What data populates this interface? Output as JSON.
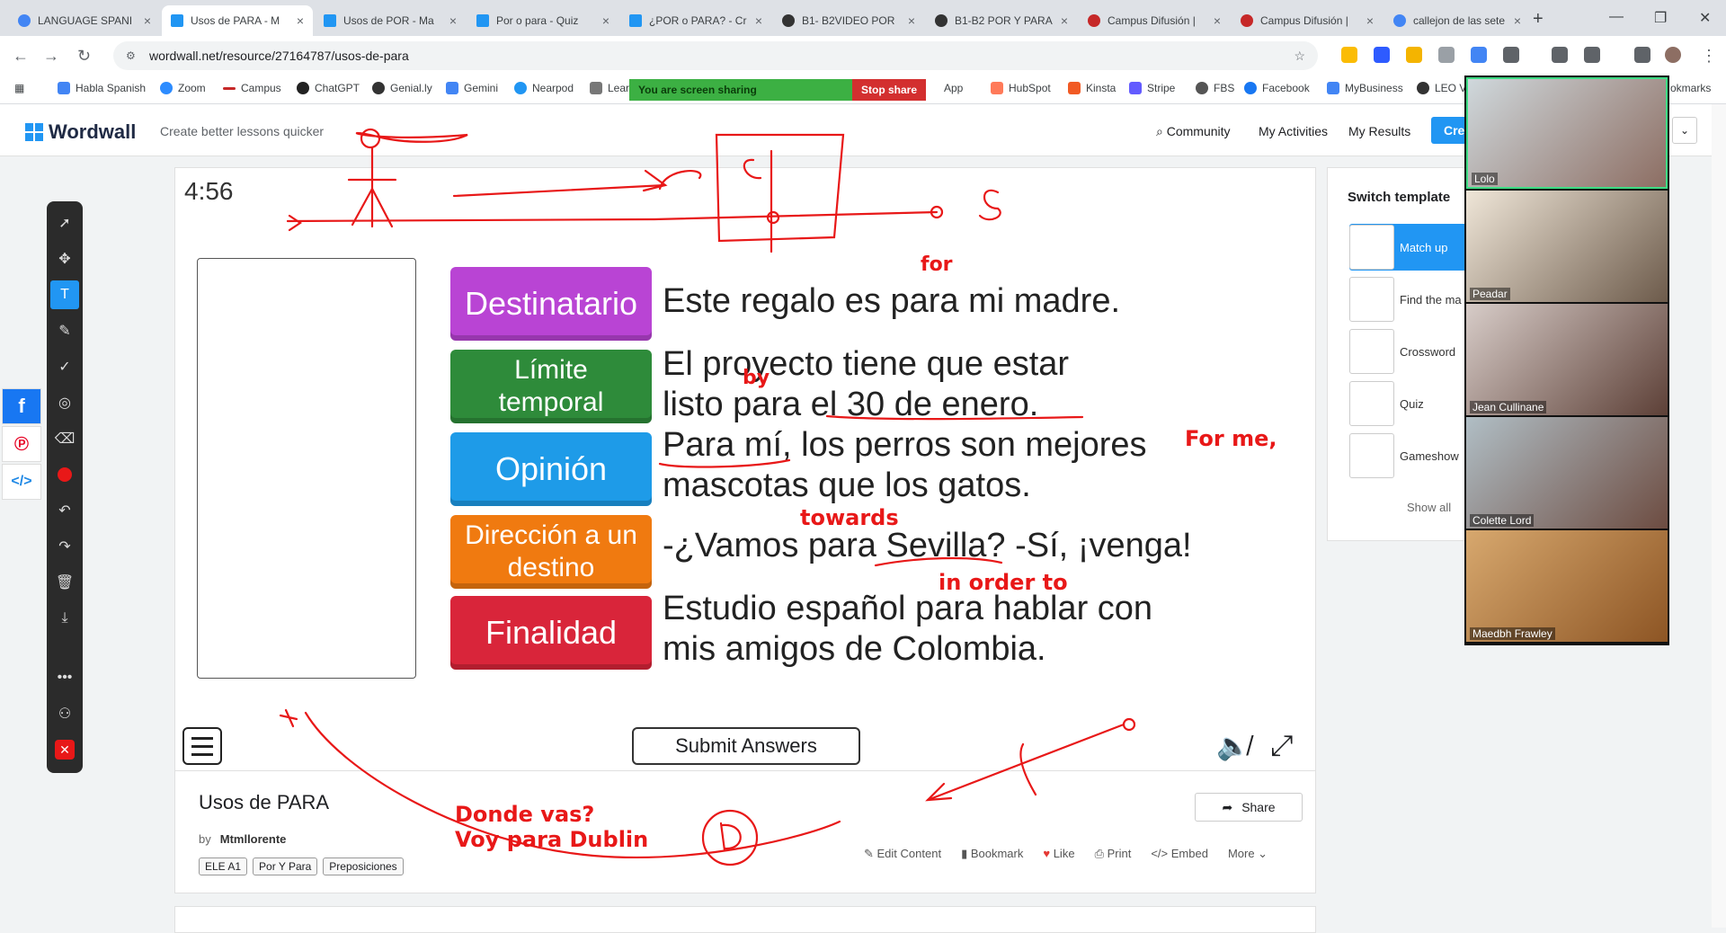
{
  "browser": {
    "tabs": [
      {
        "label": "LANGUAGE SPANI",
        "color": "#4285f4"
      },
      {
        "label": "Usos de PARA - M",
        "color": "#2196f3"
      },
      {
        "label": "Usos de POR - Ma",
        "color": "#2196f3"
      },
      {
        "label": "Por o para - Quiz",
        "color": "#2196f3"
      },
      {
        "label": "¿POR o PARA? - Cr",
        "color": "#2196f3"
      },
      {
        "label": "B1- B2VIDEO POR",
        "color": "#333333"
      },
      {
        "label": "B1-B2 POR Y PARA",
        "color": "#333333"
      },
      {
        "label": "Campus Difusión |",
        "color": "#c62828"
      },
      {
        "label": "Campus Difusión |",
        "color": "#c62828"
      },
      {
        "label": "callejon de las sete",
        "color": "#4285f4"
      }
    ],
    "url": "wordwall.net/resource/27164787/usos-de-para",
    "bookmarks": [
      "Habla Spanish",
      "Zoom",
      "Campus",
      "ChatGPT",
      "Genial.ly",
      "Gemini",
      "Nearpod",
      "Lear",
      "App",
      "HubSpot",
      "Kinsta",
      "Stripe",
      "FBS",
      "Facebook",
      "MyBusiness",
      "LEO V",
      "okmarks"
    ],
    "screen_share": {
      "status": "You are screen sharing",
      "stop": "Stop share"
    }
  },
  "wordwall": {
    "brand": "Wordwall",
    "tagline": "Create better lessons quicker",
    "nav": [
      "Community",
      "My Activities",
      "My Results"
    ],
    "create": "Cre"
  },
  "game": {
    "timer": "4:56",
    "categories": [
      {
        "label": "Destinatario",
        "color": "#b944d4"
      },
      {
        "label": "Límite temporal",
        "color": "#2e8b3a"
      },
      {
        "label": "Opinión",
        "color": "#1e9be8"
      },
      {
        "label": "Dirección a un destino",
        "color": "#f07a10"
      },
      {
        "label": "Finalidad",
        "color": "#d9253a"
      }
    ],
    "sentences": [
      "Este regalo es para mi madre.",
      "El proyecto tiene que estar listo para el 30 de enero.",
      "Para mí, los perros son mejores mascotas que los gatos.",
      "-¿Vamos para Sevilla? -Sí, ¡venga!",
      "Estudio español para hablar con mis amigos de Colombia."
    ],
    "submit": "Submit Answers"
  },
  "activity": {
    "title": "Usos de PARA",
    "by_label": "by",
    "author": "Mtmllorente",
    "tags": [
      "ELE A1",
      "Por Y Para",
      "Preposiciones"
    ],
    "share": "Share",
    "actions": [
      "Edit Content",
      "Bookmark",
      "Like",
      "Print",
      "Embed",
      "More"
    ]
  },
  "sidebar": {
    "heading": "Switch template",
    "templates": [
      "Match up",
      "Find the ma",
      "Crossword",
      "Quiz",
      "Gameshow"
    ],
    "show_all": "Show all"
  },
  "annotations": {
    "for": "for",
    "by": "by",
    "for_me": "For me,",
    "towards": "towards",
    "in_order_to": "in order to",
    "donde1": "Donde vas?",
    "donde2": "Voy para Dublin"
  },
  "participants": [
    "Lolo",
    "Peadar",
    "Jean Cullinane",
    "Colette Lord",
    "Maedbh Frawley"
  ]
}
